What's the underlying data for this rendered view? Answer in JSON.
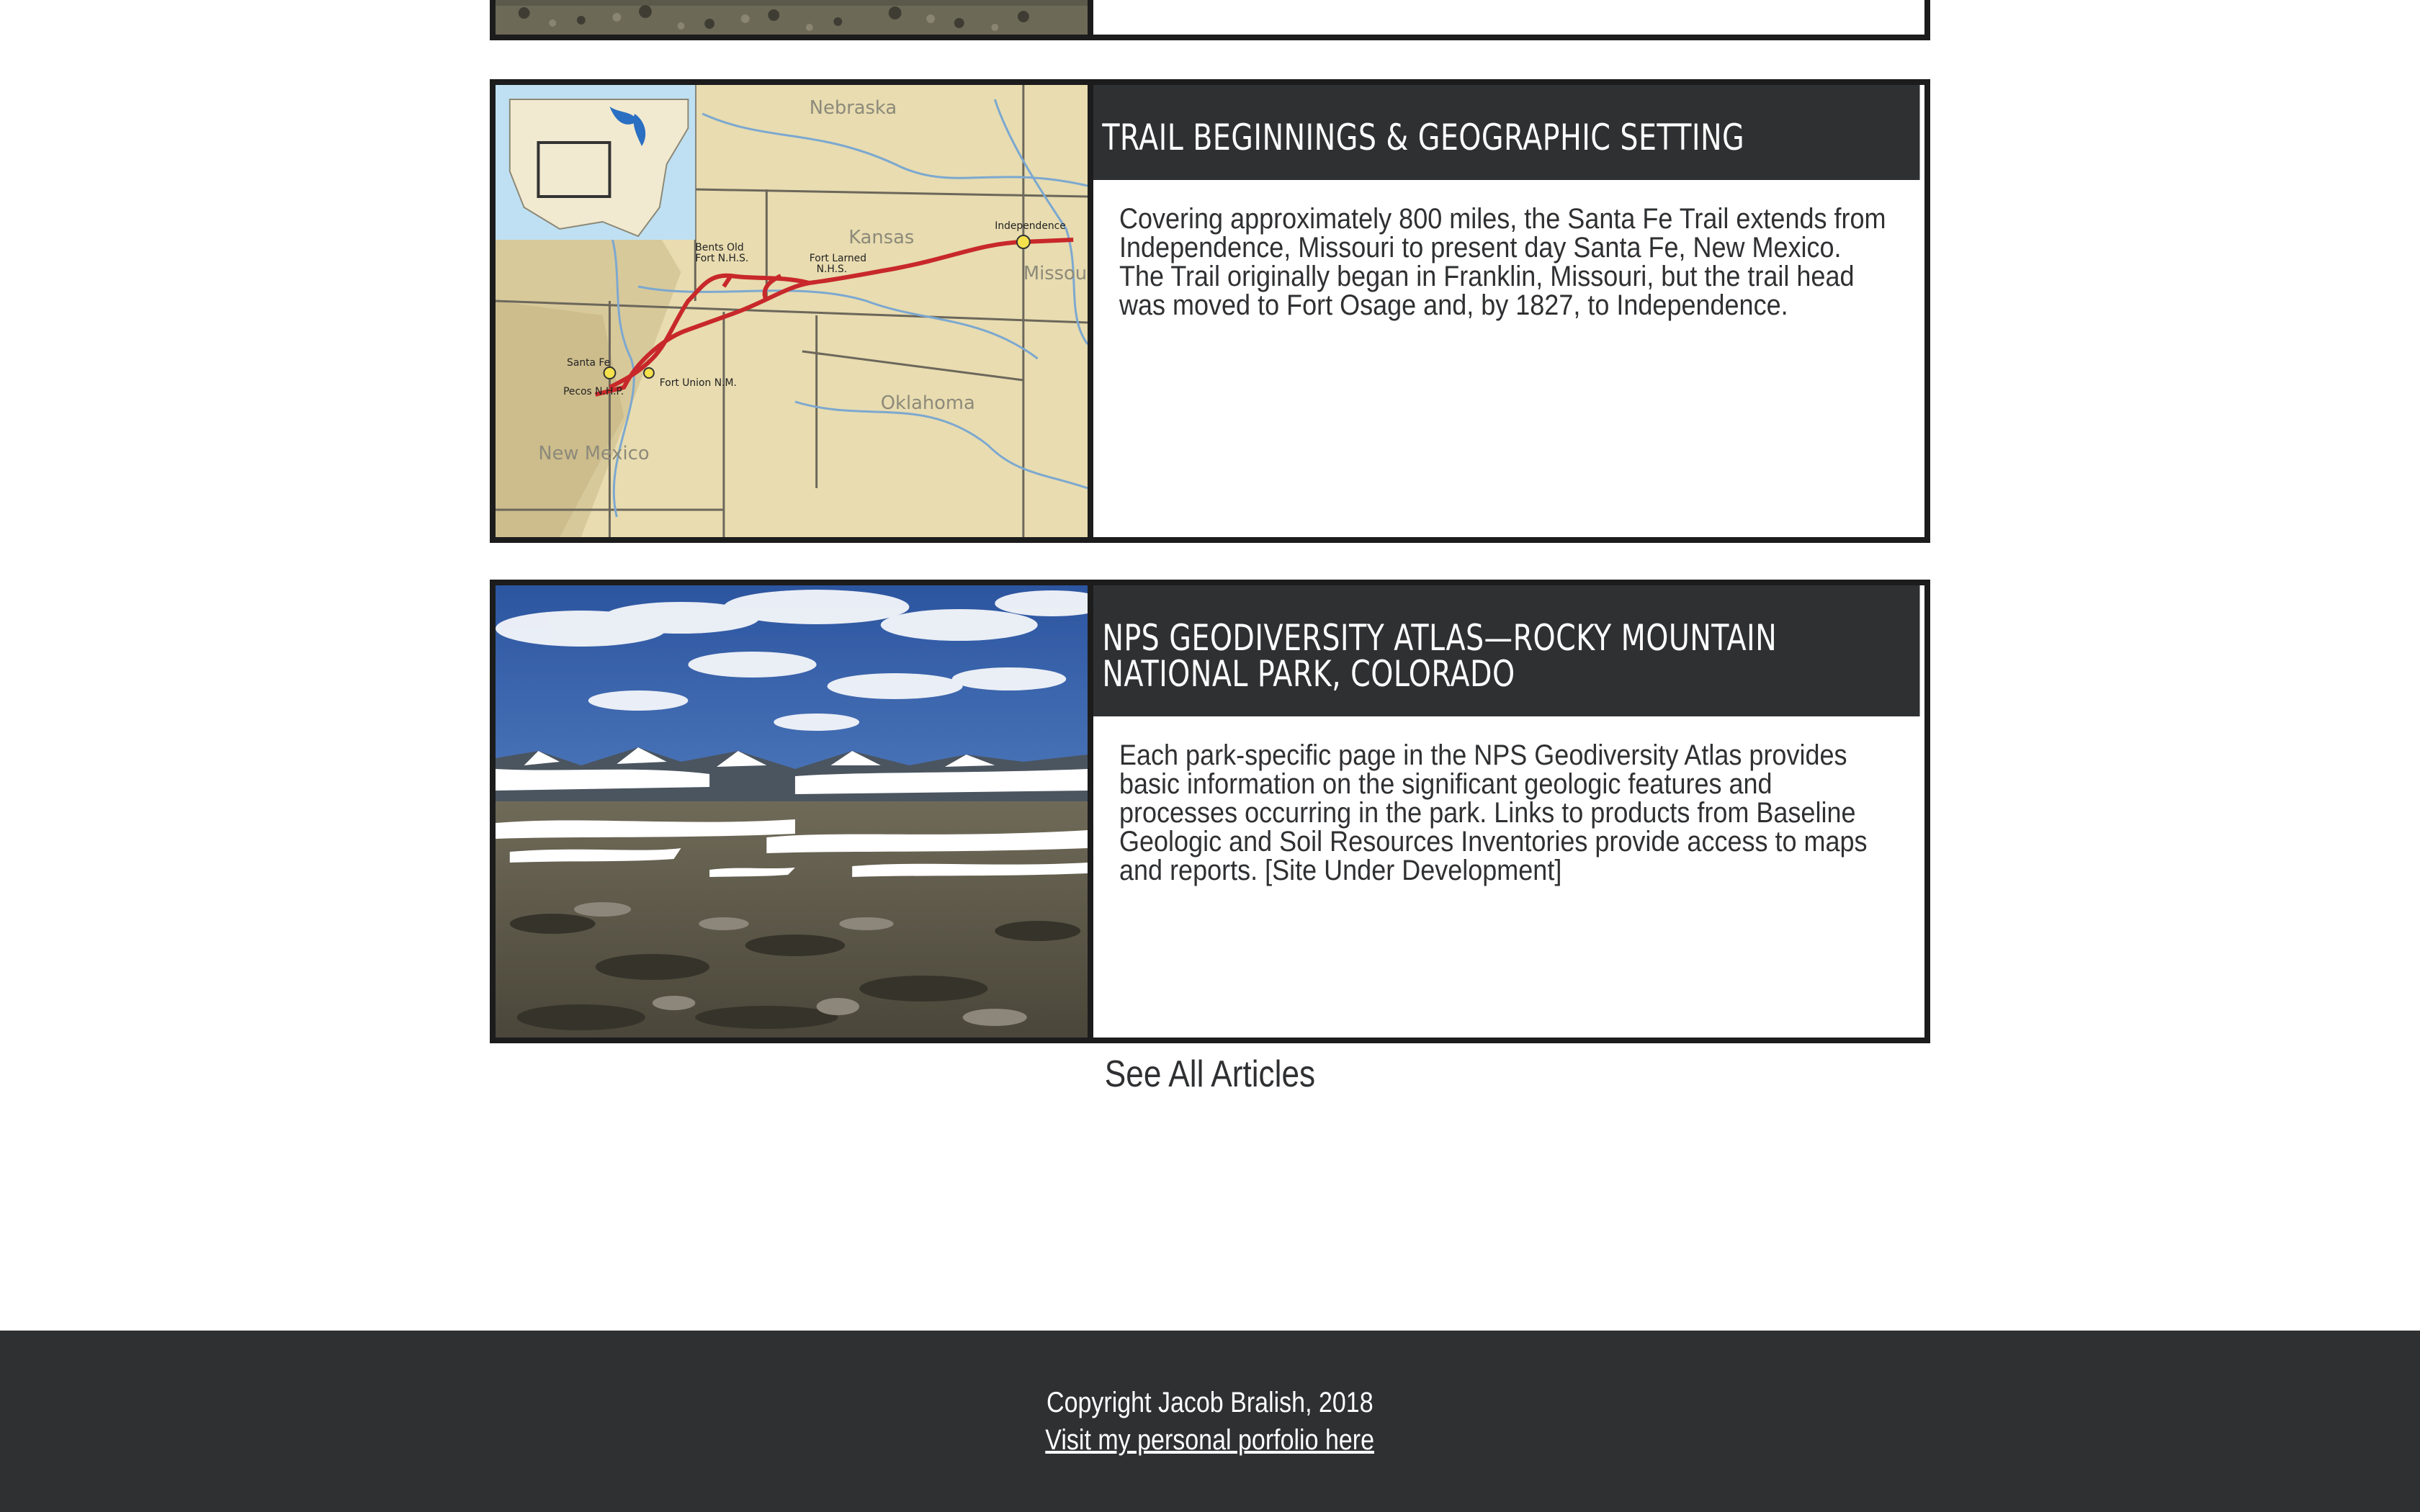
{
  "articles": [
    {
      "title": "",
      "text": "",
      "image": "mountain-landscape-photo"
    },
    {
      "title": "TRAIL BEGINNINGS & GEOGRAPHIC SETTING",
      "text": "Covering approximately 800 miles, the Santa Fe Trail extends from Independence, Missouri to present day Santa Fe, New Mexico. The Trail originally began in Franklin, Missouri, but the trail head was moved to Fort Osage and, by 1827, to Independence.",
      "image": "santa-fe-trail-map",
      "map_labels": [
        "Nebraska",
        "Kansas",
        "Missouri",
        "Oklahoma",
        "New Mexico",
        "Independence",
        "Santa Fe",
        "Bent's Old Fort N.H.S.",
        "Fort Larned N.H.S.",
        "Fort Union N.M.",
        "Pecos N.H.P."
      ]
    },
    {
      "title": "NPS GEODIVERSITY ATLAS—ROCKY MOUNTAIN NATIONAL PARK, COLORADO",
      "text": "Each park-specific page in the NPS Geodiversity Atlas provides basic information on the significant geologic features and processes occurring in the park. Links to products from Baseline Geologic and Soil Resources Inventories provide access to maps and reports. [Site Under Development]",
      "image": "rocky-mountain-tundra-photo"
    }
  ],
  "see_all": "See All Articles",
  "footer": {
    "copyright": "Copyright Jacob Bralish, 2018",
    "link": "Visit my personal porfolio here"
  },
  "colors": {
    "dark": "#2f3032",
    "border": "#1c1c1d",
    "map_sand": "#e8dcb0",
    "trail_red": "#c8282a"
  }
}
